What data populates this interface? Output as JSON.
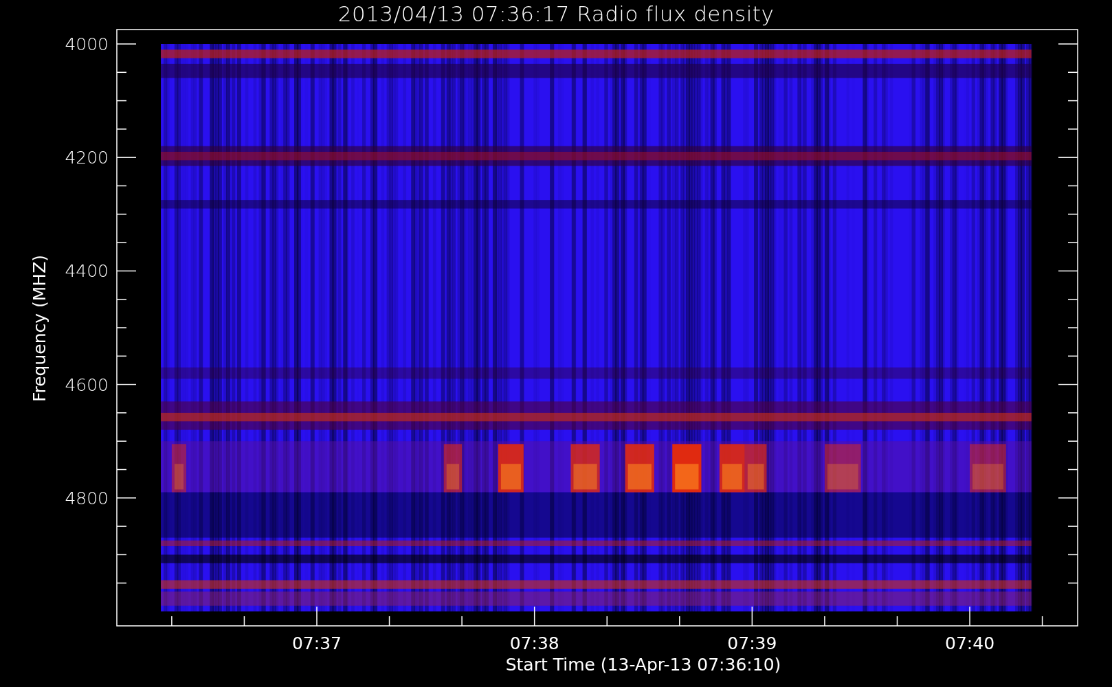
{
  "title": "2013/04/13 07:36:17 Radio flux density",
  "y_axis": {
    "label": "Frequency (MHZ)",
    "ticks": [
      "4000",
      "4200",
      "4400",
      "4600",
      "4800"
    ]
  },
  "x_axis": {
    "label": "Start Time (13-Apr-13 07:36:10)",
    "ticks": [
      "07:37",
      "07:38",
      "07:39",
      "07:40"
    ]
  }
}
